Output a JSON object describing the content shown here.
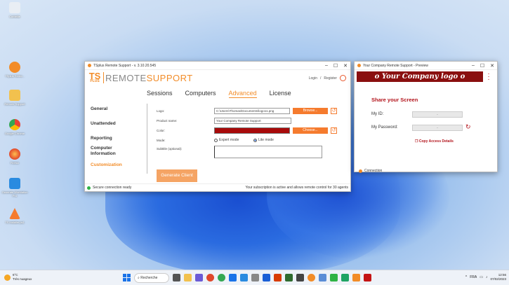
{
  "desktop": {
    "icons": [
      "Corbeille",
      "TSplus Remo...",
      "Remote Support",
      "Google Chrome",
      "Firefox",
      "Generate Worktation Pro",
      "TS Installer.ps1"
    ]
  },
  "main_window": {
    "title": "TSplus Remote Support - v. 3.10.20.545",
    "logo_ts": "TS",
    "logo_plus": "PLUS",
    "logo_remote": "REMOTE",
    "logo_support": "SUPPORT",
    "login": "Login",
    "register": "Register",
    "tabs": [
      "Sessions",
      "Computers",
      "Advanced",
      "License"
    ],
    "active_tab": "Advanced",
    "sidebar": [
      "General",
      "Unattended",
      "Reporting",
      "Computer Information",
      "Customization"
    ],
    "active_sidebar": "Customization",
    "form": {
      "logo_label": "Logo:",
      "logo_value": "C:\\Users\\Thomas\\Documents\\logo11.png",
      "product_label": "Product name:",
      "product_value": "Your Company Remote Support",
      "color_label": "Color:",
      "color_value": "#a80a0a",
      "mode_label": "Mode:",
      "mode_expert": "Expert mode",
      "mode_lite": "Lite mode",
      "subtitle_label": "Subtitle (optional):",
      "browse": "Browse...",
      "choose": "Choose..."
    },
    "generate": "Generate Client",
    "status_left": "Secure connection ready",
    "status_right": "Your subscription is active and allows remote control for 30 agents"
  },
  "preview": {
    "title": "Your Company Remote Support - Preview",
    "banner": "o Your Company logo o",
    "share": "Share your Screen",
    "my_id": "My ID:",
    "my_password": "My Password:",
    "id_value": "-",
    "password_value": "-",
    "copy": "Copy Access Details",
    "connection": "Connection"
  },
  "taskbar": {
    "temp": "6°C",
    "weather": "Très nuageux",
    "search": "Recherche",
    "lang": "FRA",
    "time": "12:56",
    "date": "07/02/2023"
  },
  "colors": {
    "accent": "#f28c28",
    "brand_red": "#8a0f0f",
    "status_green": "#2fb344"
  }
}
